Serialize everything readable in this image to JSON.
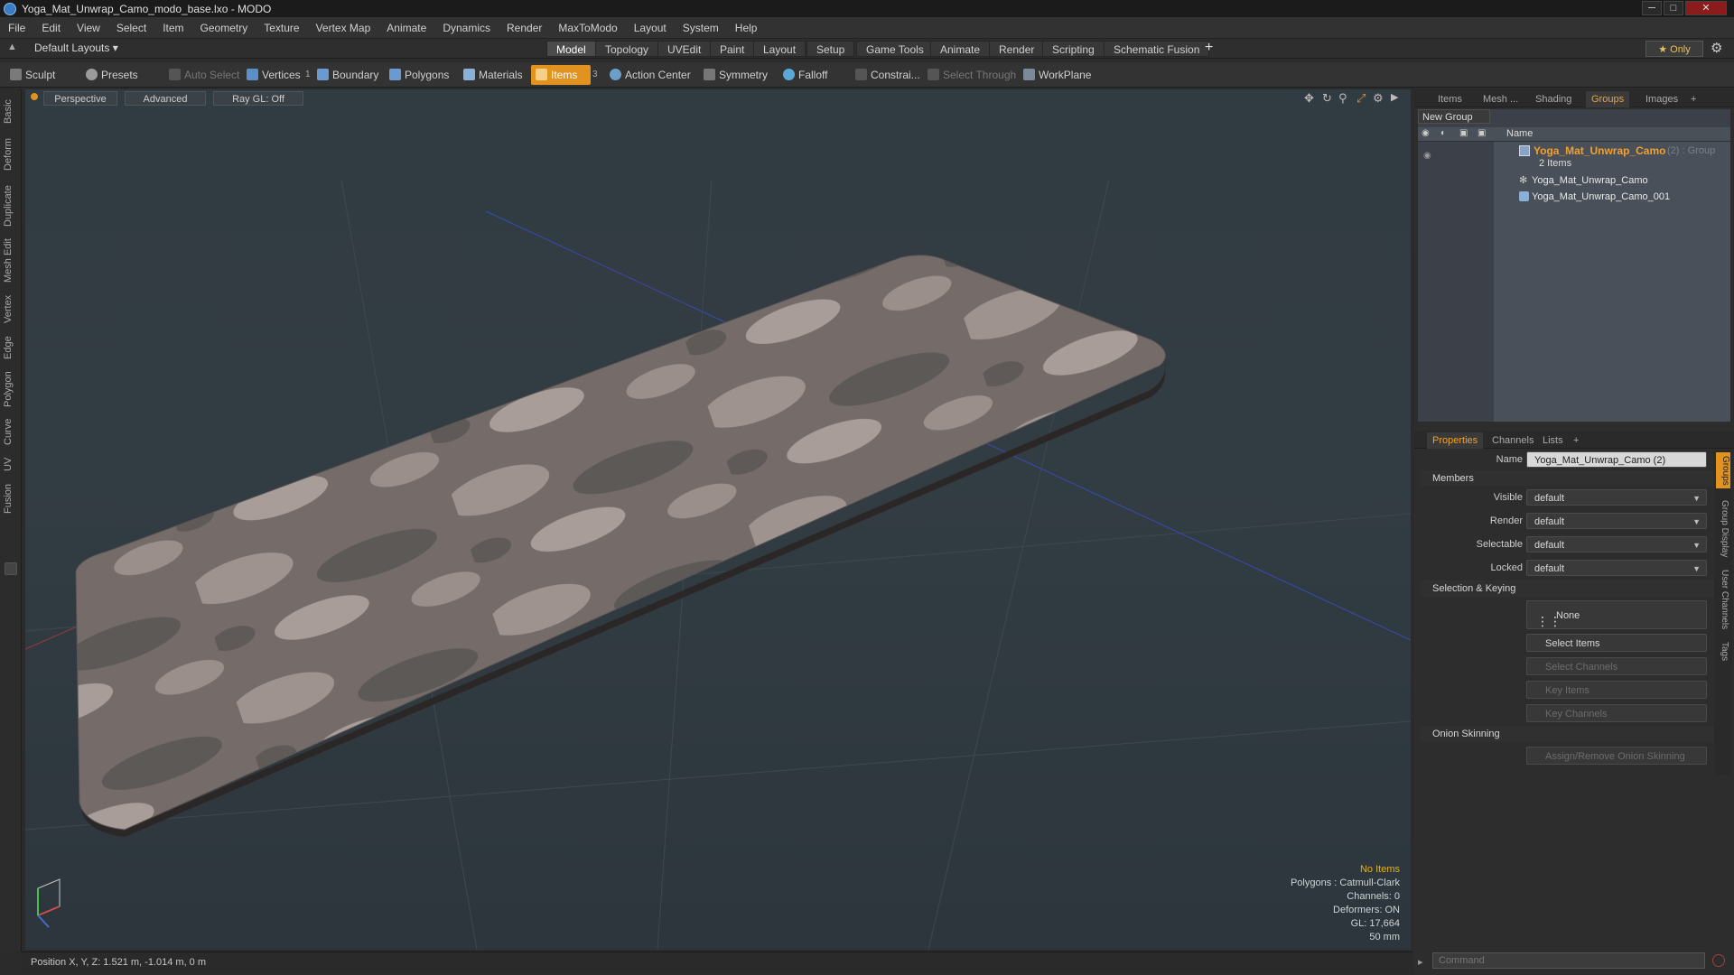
{
  "window": {
    "title": "Yoga_Mat_Unwrap_Camo_modo_base.lxo - MODO",
    "min": "─",
    "max": "□",
    "close": "✕"
  },
  "menu": [
    "File",
    "Edit",
    "View",
    "Select",
    "Item",
    "Geometry",
    "Texture",
    "Vertex Map",
    "Animate",
    "Dynamics",
    "Render",
    "MaxToModo",
    "Layout",
    "System",
    "Help"
  ],
  "layout_bar": {
    "layout_menu": "Default Layouts ▾",
    "tabs": [
      "Model",
      "Topology",
      "UVEdit",
      "Paint",
      "Layout",
      "Setup",
      "Game Tools",
      "Animate",
      "Render",
      "Scripting",
      "Schematic Fusion"
    ],
    "active_tab": "Model",
    "add": "+",
    "only": "★ Only",
    "gear": "⚙"
  },
  "toolbar": {
    "sculpt": "Sculpt",
    "presets": "Presets",
    "auto_select": "Auto Select",
    "vertices": "Vertices",
    "vertices_count": "1",
    "boundary": "Boundary",
    "polygons": "Polygons",
    "materials": "Materials",
    "items": "Items",
    "items_count": "3",
    "action_center": "Action Center",
    "symmetry": "Symmetry",
    "falloff": "Falloff",
    "constraints": "Constrai...",
    "select_through": "Select Through",
    "workplane": "WorkPlane"
  },
  "left_tabs": [
    "Basic",
    "Deform",
    "Duplicate",
    "Mesh Edit",
    "Vertex",
    "Edge",
    "Polygon",
    "Curve",
    "UV",
    "Fusion"
  ],
  "viewport": {
    "perspective": "Perspective",
    "advanced": "Advanced",
    "raygl": "Ray GL: Off",
    "hud": {
      "no_items": "No Items",
      "polygons": "Polygons : Catmull-Clark",
      "channels": "Channels: 0",
      "deformers": "Deformers: ON",
      "gl": "GL: 17,664",
      "scale": "50 mm"
    }
  },
  "status": {
    "position": "Position X, Y, Z:  1.521 m, -1.014 m, 0 m"
  },
  "groups_panel": {
    "tabs": [
      "Items",
      "Mesh ...",
      "Shading",
      "Groups",
      "Images"
    ],
    "active_tab": "Groups",
    "add": "+",
    "new_group": "New Group",
    "col_name": "Name",
    "group_name": "Yoga_Mat_Unwrap_Camo",
    "group_suffix": "(2) : Group",
    "group_count": "2 Items",
    "children": [
      "Yoga_Mat_Unwrap_Camo",
      "Yoga_Mat_Unwrap_Camo_001"
    ]
  },
  "properties": {
    "tabs": [
      "Properties",
      "Channels",
      "Lists"
    ],
    "active_tab": "Properties",
    "add": "+",
    "name_label": "Name",
    "name_value": "Yoga_Mat_Unwrap_Camo (2)",
    "members": "Members",
    "fields": [
      {
        "label": "Visible",
        "value": "default"
      },
      {
        "label": "Render",
        "value": "default"
      },
      {
        "label": "Selectable",
        "value": "default"
      },
      {
        "label": "Locked",
        "value": "default"
      }
    ],
    "selection_keying": "Selection & Keying",
    "none": "None",
    "select_items": "Select Items",
    "select_channels": "Select Channels",
    "key_items": "Key Items",
    "key_channels": "Key Channels",
    "onion": "Onion Skinning",
    "onion_btn": "Assign/Remove Onion Skinning",
    "side_tabs": [
      "Groups",
      "Group Display",
      "User Channels",
      "Tags"
    ]
  },
  "command": {
    "placeholder": "Command"
  },
  "colors": {
    "accent": "#e2921e",
    "group_name": "#f0a030"
  }
}
